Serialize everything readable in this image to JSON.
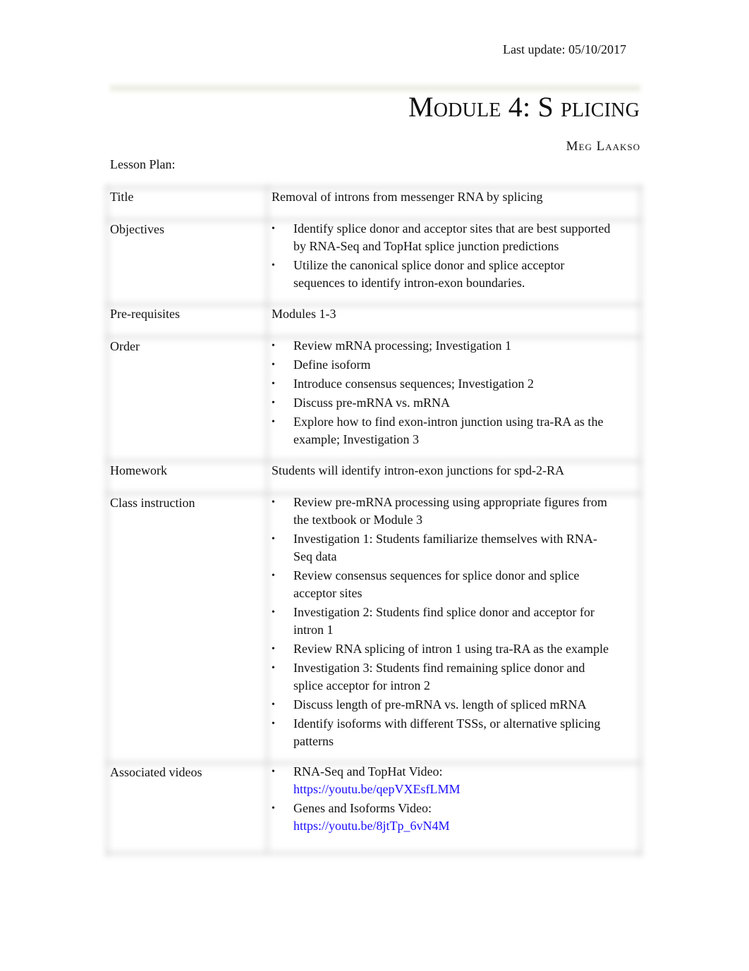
{
  "header": {
    "last_update": "Last update: 05/10/2017",
    "module_title": "Module 4: S plicing",
    "author": "Meg Laakso",
    "lesson_plan_label": "Lesson Plan:"
  },
  "lesson_plan": {
    "bullet_glyph": "•",
    "rows": [
      {
        "label": "Title",
        "value": "Removal of introns from messenger RNA by splicing"
      },
      {
        "label": "Objectives",
        "items": [
          "Identify splice donor and acceptor sites that are best supported by RNA-Seq and TopHat splice junction predictions",
          "Utilize the canonical splice donor and splice acceptor sequences to identify intron-exon boundaries."
        ]
      },
      {
        "label": "Pre-requisites",
        "value": "Modules 1-3"
      },
      {
        "label": "Order",
        "items": [
          "Review mRNA processing; Investigation 1",
          "Define isoform",
          "Introduce consensus sequences; Investigation 2",
          "Discuss pre-mRNA vs. mRNA",
          "Explore how to find exon-intron junction using tra-RA as the example; Investigation 3"
        ]
      },
      {
        "label": "Homework",
        "value": "Students will identify intron-exon junctions for spd-2-RA"
      },
      {
        "label": "Class instruction",
        "items": [
          "Review pre-mRNA processing using appropriate figures from the textbook or Module 3",
          "Investigation 1: Students familiarize themselves with RNA-Seq data",
          "Review consensus sequences for splice donor and splice acceptor sites",
          "Investigation 2: Students find splice donor and acceptor for intron 1",
          "Review RNA splicing of intron 1 using tra-RA as the example",
          "Investigation 3: Students find remaining splice donor and splice acceptor for intron 2",
          "Discuss length of pre-mRNA vs. length of spliced mRNA",
          "Identify isoforms with different TSSs, or alternative splicing patterns"
        ]
      },
      {
        "label": "Associated videos",
        "videos": [
          {
            "label": "RNA-Seq and TopHat Video:",
            "url": "https://youtu.be/qepVXEsfLMM"
          },
          {
            "label": "Genes and Isoforms Video:",
            "url": "https://youtu.be/8jtTp_6vN4M"
          }
        ]
      }
    ]
  },
  "colors": {
    "link": "#1a0dff",
    "text": "#111111"
  }
}
